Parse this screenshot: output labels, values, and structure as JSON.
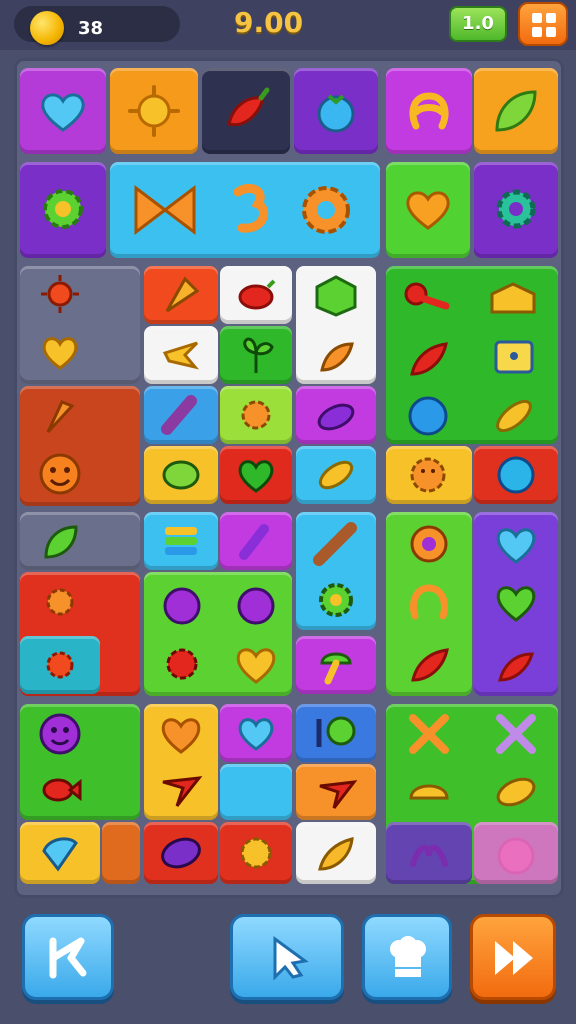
{
  "hud": {
    "coins": "38",
    "timer": "9.00",
    "level_label": "1.0"
  },
  "board": {
    "rows": [
      [
        {
          "color": "#b43bd8",
          "icon": "heart-icon"
        },
        {
          "color": "#f59a1b",
          "icon": "sun-icon"
        },
        {
          "color": "#2f2f4a",
          "icon": "pepper-icon"
        },
        {
          "color": "#7a2fc9",
          "icon": "berry-icon"
        },
        {
          "color": "#c23be0",
          "icon": "pretzel-icon"
        },
        {
          "color": "#f7a21f",
          "icon": "leaf-icon"
        }
      ]
    ]
  },
  "controls": {
    "back": "back-icon",
    "pointer": "cursor-icon",
    "hint": "chef-hat-icon",
    "fast_forward": "fast-forward-icon"
  }
}
